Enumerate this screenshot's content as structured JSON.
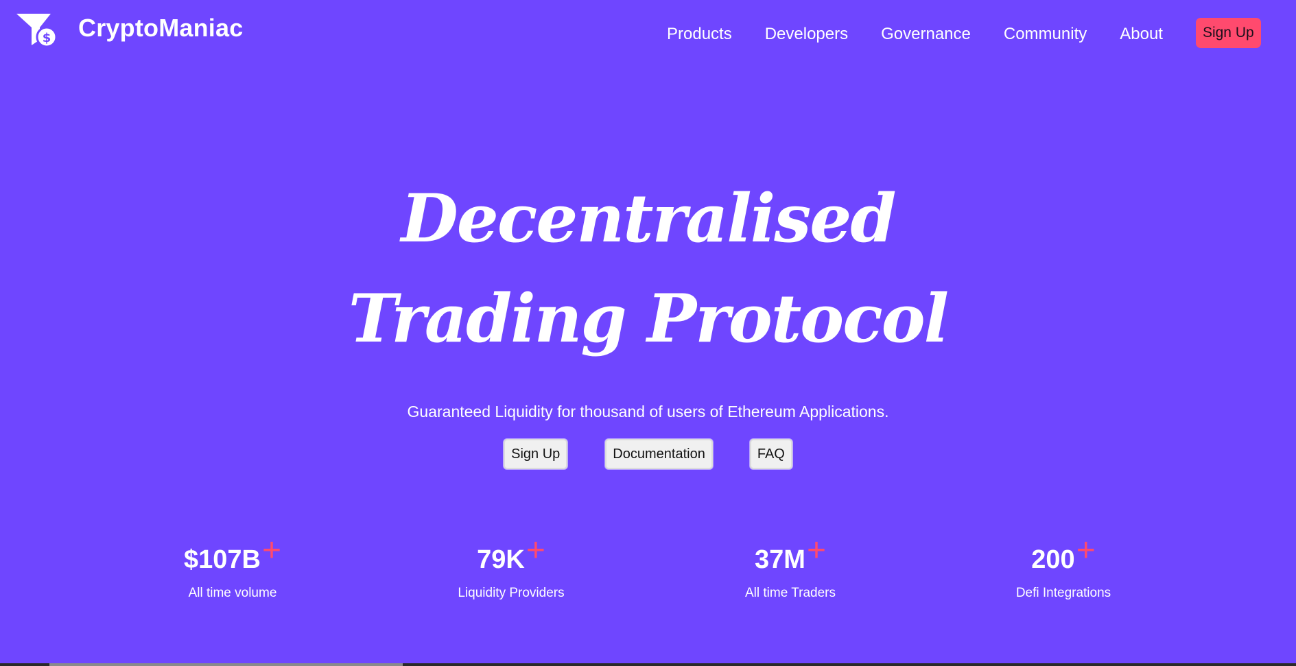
{
  "header": {
    "brand_name": "CryptoManiac",
    "logo_icon": "funnel-dollar-icon",
    "nav": [
      {
        "label": "Products"
      },
      {
        "label": "Developers"
      },
      {
        "label": "Governance"
      },
      {
        "label": "Community"
      },
      {
        "label": "About"
      }
    ],
    "signup_label": "Sign Up",
    "signup_color": "#ff4a6e"
  },
  "hero": {
    "title_line1": "Decentralised",
    "title_line2": "Trading Protocol",
    "subtitle": "Guaranteed Liquidity for thousand of users of Ethereum Applications.",
    "buttons": {
      "signup": "Sign Up",
      "documentation": "Documentation",
      "faq": "FAQ"
    }
  },
  "stats": [
    {
      "value": "$107B",
      "plus": "+",
      "label": "All time volume"
    },
    {
      "value": "79K",
      "plus": "+",
      "label": "Liquidity Providers"
    },
    {
      "value": "37M",
      "plus": "+",
      "label": "All time Traders"
    },
    {
      "value": "200",
      "plus": "+",
      "label": "Defi Integrations"
    }
  ],
  "colors": {
    "background": "#6f46ff",
    "accent": "#ff4a6e",
    "text": "#ffffff"
  }
}
